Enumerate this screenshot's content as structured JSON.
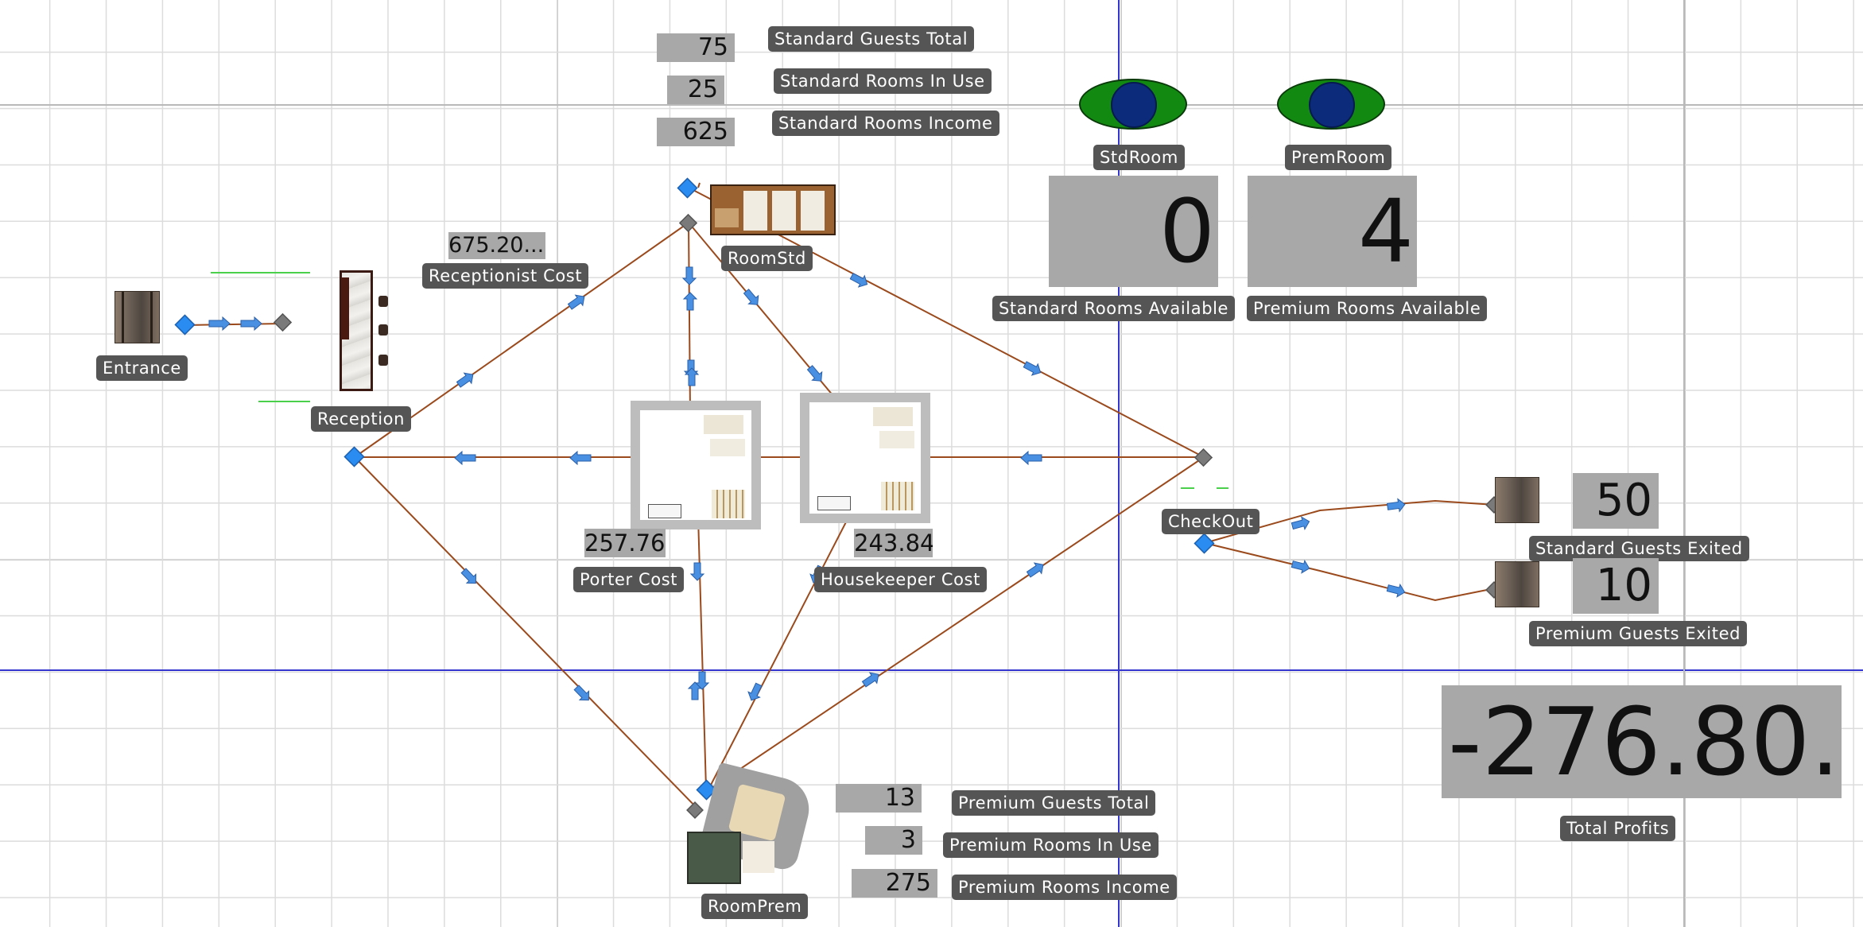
{
  "nodes": {
    "entrance": "Entrance",
    "reception": "Reception",
    "room_std": "RoomStd",
    "room_prem": "RoomPrem",
    "checkout": "CheckOut",
    "std_room_resource": "StdRoom",
    "prem_room_resource": "PremRoom"
  },
  "standard": {
    "guests_total_value": "75",
    "guests_total_label": "Standard Guests Total",
    "rooms_in_use_value": "25",
    "rooms_in_use_label": "Standard Rooms In Use",
    "rooms_income_value": "625",
    "rooms_income_label": "Standard Rooms Income",
    "rooms_available_value": "0",
    "rooms_available_label": "Standard Rooms Available",
    "guests_exited_value": "50",
    "guests_exited_label": "Standard Guests Exited"
  },
  "premium": {
    "guests_total_value": "13",
    "guests_total_label": "Premium Guests Total",
    "rooms_in_use_value": "3",
    "rooms_in_use_label": "Premium Rooms In Use",
    "rooms_income_value": "275",
    "rooms_income_label": "Premium Rooms Income",
    "rooms_available_value": "4",
    "rooms_available_label": "Premium Rooms Available",
    "guests_exited_value": "10",
    "guests_exited_label": "Premium Guests Exited"
  },
  "costs": {
    "receptionist_value": "675.20...",
    "receptionist_label": "Receptionist Cost",
    "porter_value": "257.76",
    "porter_label": "Porter Cost",
    "housekeeper_value": "243.84",
    "housekeeper_label": "Housekeeper Cost"
  },
  "profits": {
    "value": "-276.80...",
    "label": "Total Profits"
  },
  "colors": {
    "link_line": "#9a4a1c",
    "node_entry": "#2a8cf0",
    "node_exit": "#7a7a7a",
    "view_axis": "#3535d0",
    "label_bg": "#555555",
    "value_bg": "#a8a8a8",
    "eye_green": "#128a12",
    "eye_blue": "#0c2b7a"
  },
  "icons": {
    "visibility": "eye-icon",
    "node_in": "diamond-blue-icon",
    "node_out": "diamond-gray-icon",
    "flow": "arrow-icon"
  }
}
